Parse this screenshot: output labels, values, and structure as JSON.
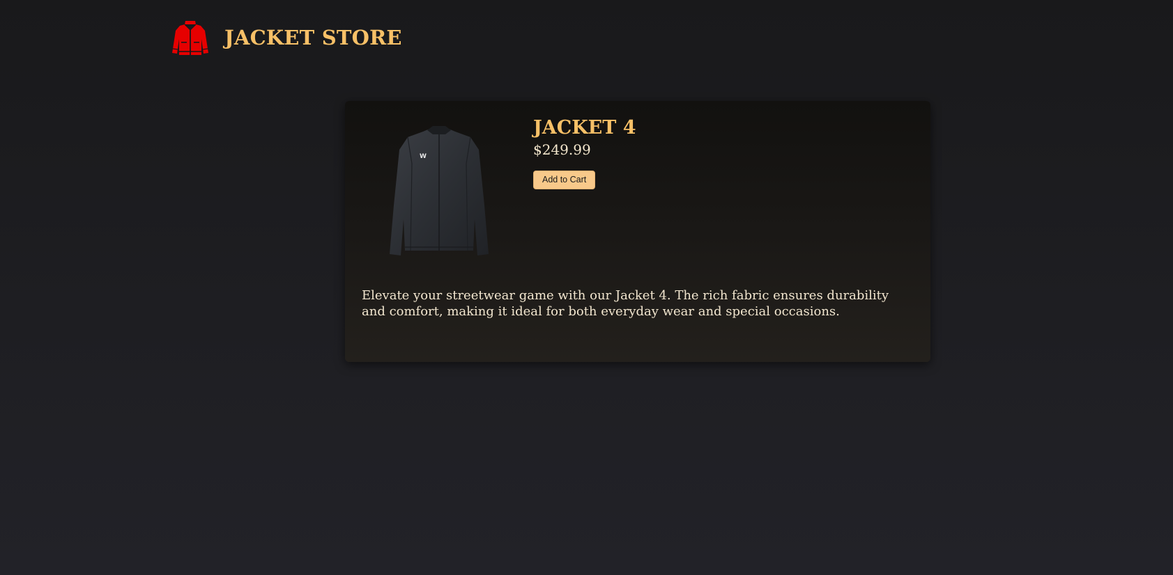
{
  "header": {
    "logo_icon": "jacket-icon",
    "title": "JACKET STORE"
  },
  "product": {
    "name": "JACKET 4",
    "price": "$249.99",
    "add_to_cart_label": "Add to Cart",
    "image_icon": "jacket-photo",
    "description": "Elevate your streetwear game with our Jacket 4. The rich fabric ensures durability and comfort, making it ideal for both everyday wear and special occasions."
  },
  "colors": {
    "accent": "#f7c067",
    "logo": "#e60000",
    "button": "#f8c98a"
  }
}
